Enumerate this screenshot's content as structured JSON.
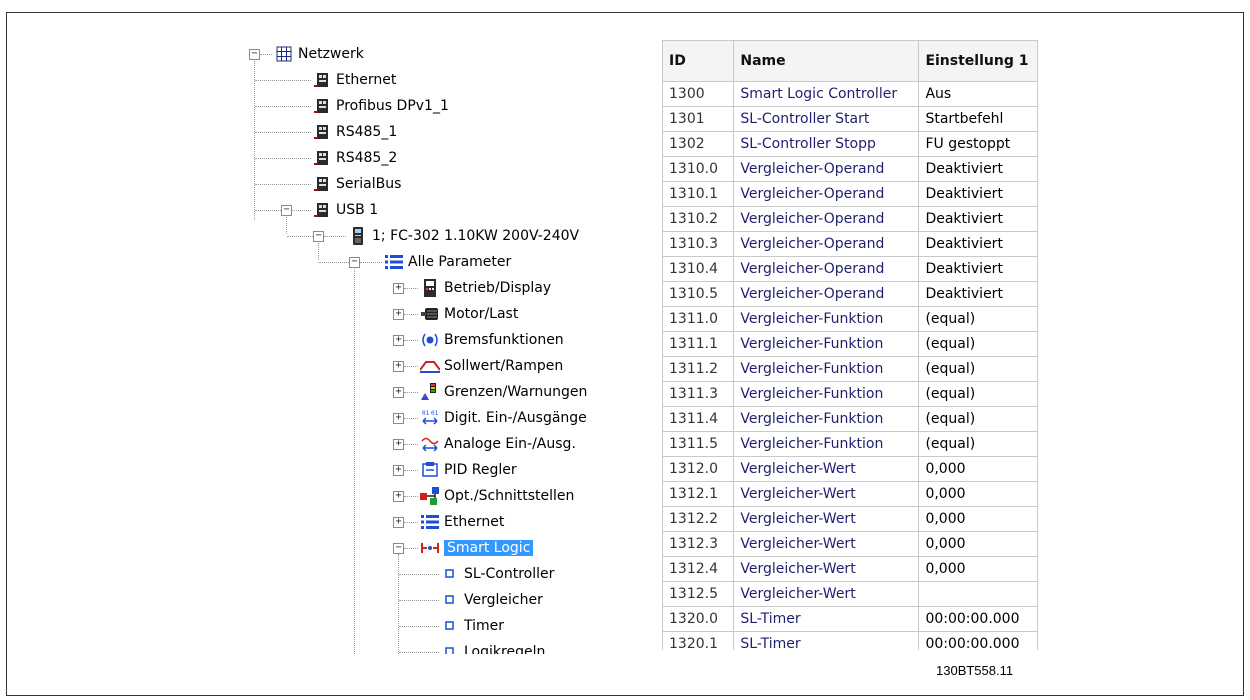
{
  "tree": {
    "root_label": "Netzwerk",
    "ports": [
      {
        "label": "Ethernet"
      },
      {
        "label": "Profibus DPv1_1"
      },
      {
        "label": "RS485_1"
      },
      {
        "label": "RS485_2"
      },
      {
        "label": "SerialBus"
      },
      {
        "label": "USB 1"
      }
    ],
    "device_label": "1; FC-302 1.10KW 200V-240V",
    "all_params_label": "Alle Parameter",
    "groups": [
      {
        "label": "Betrieb/Display",
        "icon": "display-icon"
      },
      {
        "label": "Motor/Last",
        "icon": "motor-icon"
      },
      {
        "label": "Bremsfunktionen",
        "icon": "brake-icon"
      },
      {
        "label": "Sollwert/Rampen",
        "icon": "ramp-icon"
      },
      {
        "label": "Grenzen/Warnungen",
        "icon": "warning-icon"
      },
      {
        "label": "Digit. Ein-/Ausgänge",
        "icon": "digital-io-icon"
      },
      {
        "label": "Analoge Ein-/Ausg.",
        "icon": "analog-io-icon"
      },
      {
        "label": "PID Regler",
        "icon": "pid-icon"
      },
      {
        "label": "Opt./Schnittstellen",
        "icon": "options-icon"
      },
      {
        "label": "Ethernet",
        "icon": "list-icon"
      },
      {
        "label": "Smart Logic",
        "icon": "smart-logic-icon"
      }
    ],
    "smart_logic_children": [
      {
        "label": "SL-Controller"
      },
      {
        "label": "Vergleicher"
      },
      {
        "label": "Timer"
      },
      {
        "label": "Logikregeln"
      }
    ]
  },
  "table": {
    "columns": [
      "ID",
      "Name",
      "Einstellung 1"
    ],
    "rows": [
      {
        "id": "1300",
        "name": "Smart Logic Controller",
        "value": "Aus"
      },
      {
        "id": "1301",
        "name": "SL-Controller Start",
        "value": "Startbefehl"
      },
      {
        "id": "1302",
        "name": "SL-Controller Stopp",
        "value": "FU gestoppt"
      },
      {
        "id": "1310.0",
        "name": "Vergleicher-Operand",
        "value": "Deaktiviert"
      },
      {
        "id": "1310.1",
        "name": "Vergleicher-Operand",
        "value": "Deaktiviert"
      },
      {
        "id": "1310.2",
        "name": "Vergleicher-Operand",
        "value": "Deaktiviert"
      },
      {
        "id": "1310.3",
        "name": "Vergleicher-Operand",
        "value": "Deaktiviert"
      },
      {
        "id": "1310.4",
        "name": "Vergleicher-Operand",
        "value": "Deaktiviert"
      },
      {
        "id": "1310.5",
        "name": "Vergleicher-Operand",
        "value": "Deaktiviert"
      },
      {
        "id": "1311.0",
        "name": "Vergleicher-Funktion",
        "value": " (equal)"
      },
      {
        "id": "1311.1",
        "name": "Vergleicher-Funktion",
        "value": " (equal)"
      },
      {
        "id": "1311.2",
        "name": "Vergleicher-Funktion",
        "value": " (equal)"
      },
      {
        "id": "1311.3",
        "name": "Vergleicher-Funktion",
        "value": " (equal)"
      },
      {
        "id": "1311.4",
        "name": "Vergleicher-Funktion",
        "value": " (equal)"
      },
      {
        "id": "1311.5",
        "name": "Vergleicher-Funktion",
        "value": " (equal)"
      },
      {
        "id": "1312.0",
        "name": "Vergleicher-Wert",
        "value": "0,000"
      },
      {
        "id": "1312.1",
        "name": "Vergleicher-Wert",
        "value": "0,000"
      },
      {
        "id": "1312.2",
        "name": "Vergleicher-Wert",
        "value": "0,000"
      },
      {
        "id": "1312.3",
        "name": "Vergleicher-Wert",
        "value": "0,000"
      },
      {
        "id": "1312.4",
        "name": "Vergleicher-Wert",
        "value": "0,000"
      },
      {
        "id": "1312.5",
        "name": "Vergleicher-Wert",
        "value": ""
      },
      {
        "id": "1320.0",
        "name": "SL-Timer",
        "value": "00:00:00.000"
      },
      {
        "id": "1320.1",
        "name": "SL-Timer",
        "value": "00:00:00.000"
      }
    ]
  },
  "doc_code": "130BT558.11",
  "colors": {
    "selection": "#3399ff",
    "name_text": "#1f1f6e",
    "grid": "#c9c9c9"
  }
}
